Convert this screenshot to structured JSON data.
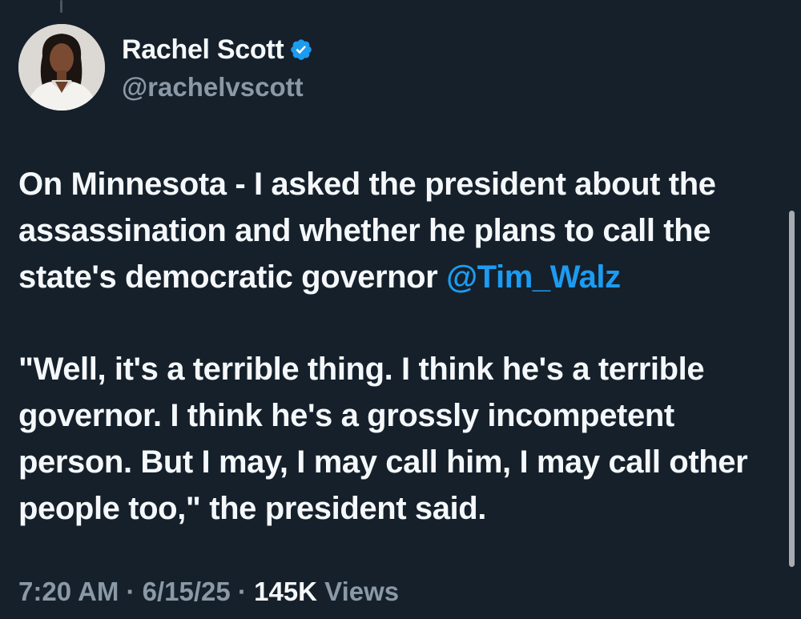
{
  "author": {
    "display_name": "Rachel Scott",
    "handle": "@rachelvscott",
    "verified_icon": "verified-badge-icon",
    "verified_color": "#1d9bf0"
  },
  "tweet": {
    "paragraph1_text": "On Minnesota - I asked the president about the assassination and whether he plans to call the state's democratic governor ",
    "paragraph1_mention": "@Tim_Walz",
    "paragraph2_text": "\"Well, it's a terrible thing. I think he's a terrible governor. I think he's a grossly incompetent person. But I may, I may call him, I may call other people too,\" the president said."
  },
  "meta": {
    "time": "7:20 AM",
    "separator": " · ",
    "date": "6/15/25",
    "views_count": "145K",
    "views_label": " Views"
  },
  "colors": {
    "background": "#15202b",
    "text_primary": "#f5f8fa",
    "text_secondary": "#8b98a5",
    "link": "#1d9bf0"
  }
}
